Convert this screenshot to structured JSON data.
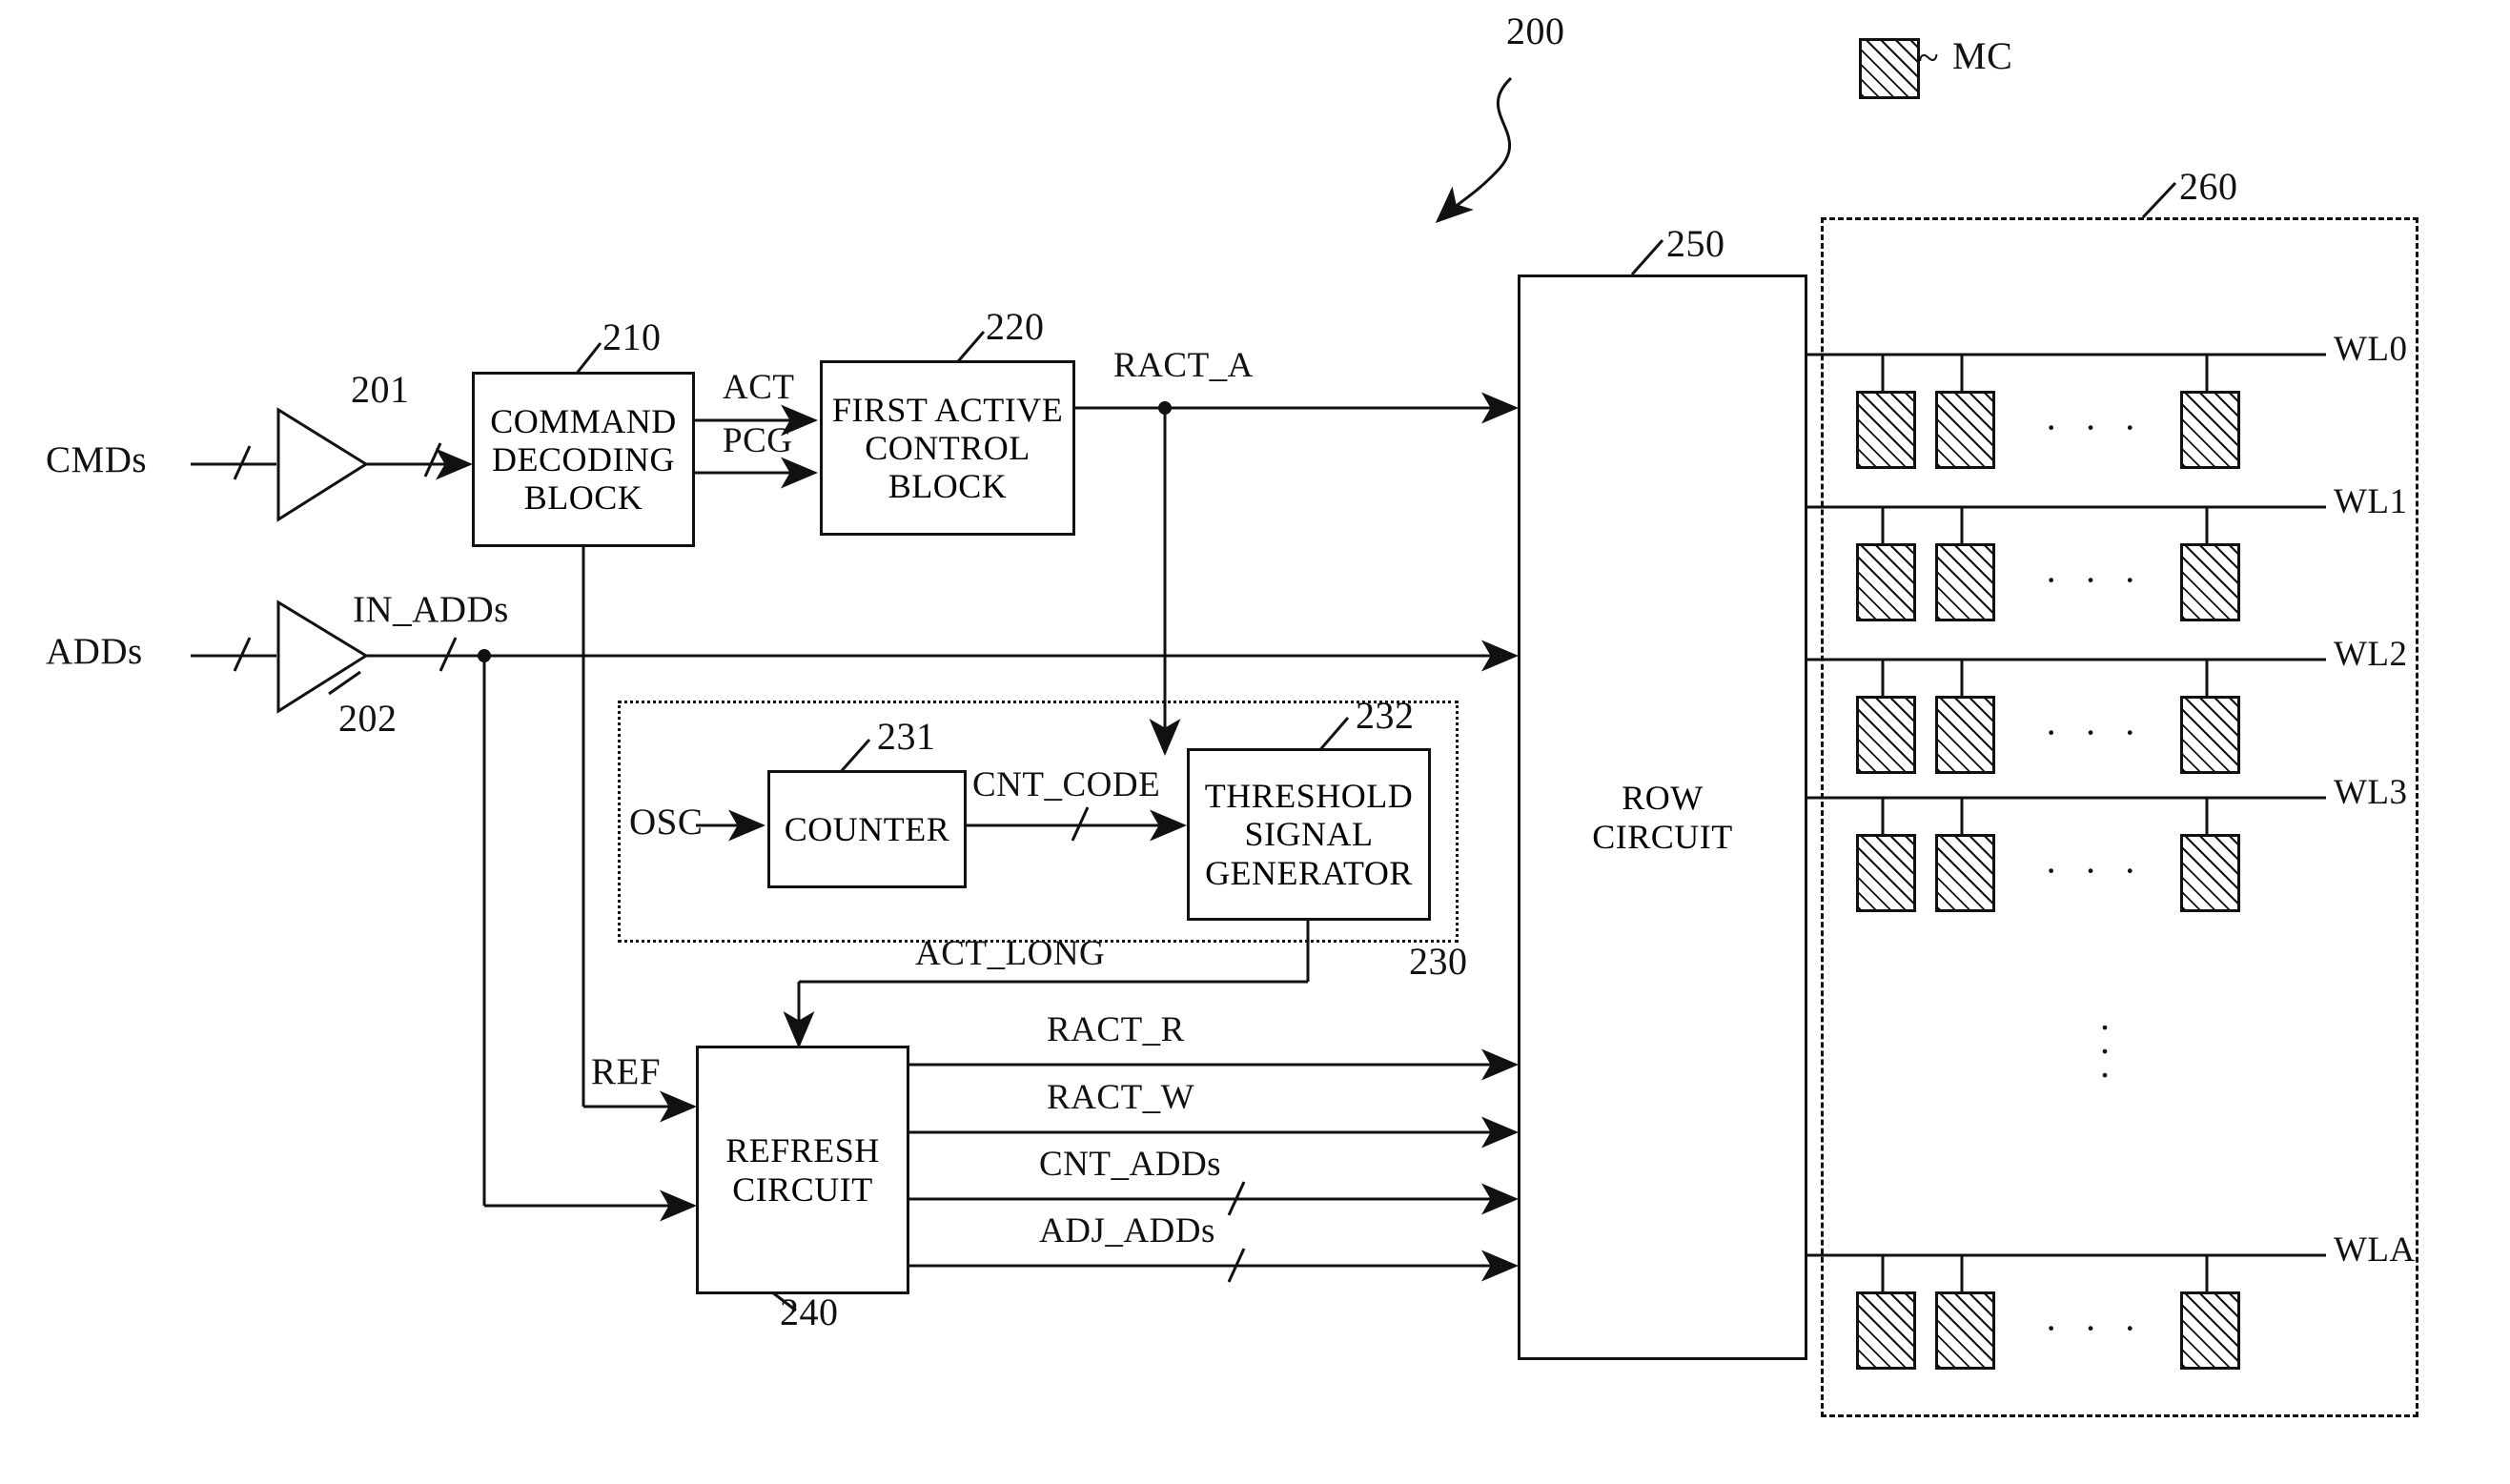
{
  "figure": {
    "ref_numeral": "200",
    "legend": {
      "symbol_label": "MC",
      "tilde": "~"
    }
  },
  "inputs": {
    "cmds": "CMDs",
    "adds": "ADDs",
    "in_adds": "IN_ADDs",
    "osc": "OSC",
    "ref": "REF"
  },
  "buffers": [
    {
      "ref": "201",
      "name": "command-buffer"
    },
    {
      "ref": "202",
      "name": "address-buffer"
    }
  ],
  "blocks": {
    "command_decoding": {
      "ref": "210",
      "line1": "COMMAND",
      "line2": "DECODING",
      "line3": "BLOCK"
    },
    "first_active_control": {
      "ref": "220",
      "line1": "FIRST ACTIVE",
      "line2": "CONTROL",
      "line3": "BLOCK"
    },
    "active_monitor": {
      "ref": "230"
    },
    "counter": {
      "ref": "231",
      "label": "COUNTER"
    },
    "threshold_signal_generator": {
      "ref": "232",
      "line1": "THRESHOLD",
      "line2": "SIGNAL",
      "line3": "GENERATOR"
    },
    "refresh_circuit": {
      "ref": "240",
      "line1": "REFRESH",
      "line2": "CIRCUIT"
    },
    "row_circuit": {
      "ref": "250",
      "line1": "ROW",
      "line2": "CIRCUIT"
    },
    "memory_bank": {
      "ref": "260"
    }
  },
  "signals": {
    "act": "ACT",
    "pcg": "PCG",
    "ract_a": "RACT_A",
    "cnt_code": "CNT_CODE",
    "act_long": "ACT_LONG",
    "ract_r": "RACT_R",
    "ract_w": "RACT_W",
    "cnt_adds": "CNT_ADDs",
    "adj_adds": "ADJ_ADDs"
  },
  "wordlines": [
    {
      "label": "WL0"
    },
    {
      "label": "WL1"
    },
    {
      "label": "WL2"
    },
    {
      "label": "WL3"
    },
    {
      "label": "WLA"
    }
  ],
  "ellipsis": {
    "horizontal": "· · ·",
    "vertical": "⋮"
  },
  "colors": {
    "ink": "#111111",
    "paper": "#ffffff"
  }
}
